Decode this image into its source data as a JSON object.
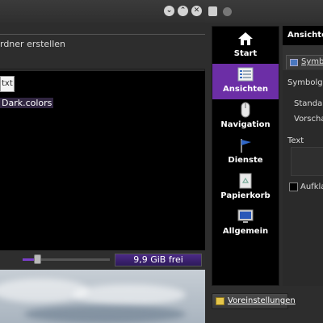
{
  "file_manager": {
    "window_buttons": [
      "⌄",
      "⌃",
      "✕"
    ],
    "toolbar_label": "rdner erstellen",
    "file": {
      "icon_text": "txt",
      "name": "Dark.colors"
    },
    "statusbar": {
      "free_space": "9,9 GiB frei",
      "zoom_level": 0.13
    }
  },
  "settings_dialog": {
    "sidebar": [
      {
        "label": "Start",
        "icon": "home-icon"
      },
      {
        "label": "Ansichten",
        "icon": "views-icon",
        "active": true
      },
      {
        "label": "Navigation",
        "icon": "mouse-icon"
      },
      {
        "label": "Dienste",
        "icon": "flag-icon"
      },
      {
        "label": "Papierkorb",
        "icon": "trash-icon"
      },
      {
        "label": "Allgemein",
        "icon": "monitor-icon"
      }
    ],
    "panel": {
      "title": "Ansichten",
      "tab": "Symbo",
      "symbol_size": "Symbolgrö",
      "standard": "Standarc",
      "preview": "Vorschau",
      "text": "Text",
      "expand": "Aufklap"
    },
    "defaults_button": "Voreinstellungen",
    "accent_color": "#6c2ea6"
  }
}
